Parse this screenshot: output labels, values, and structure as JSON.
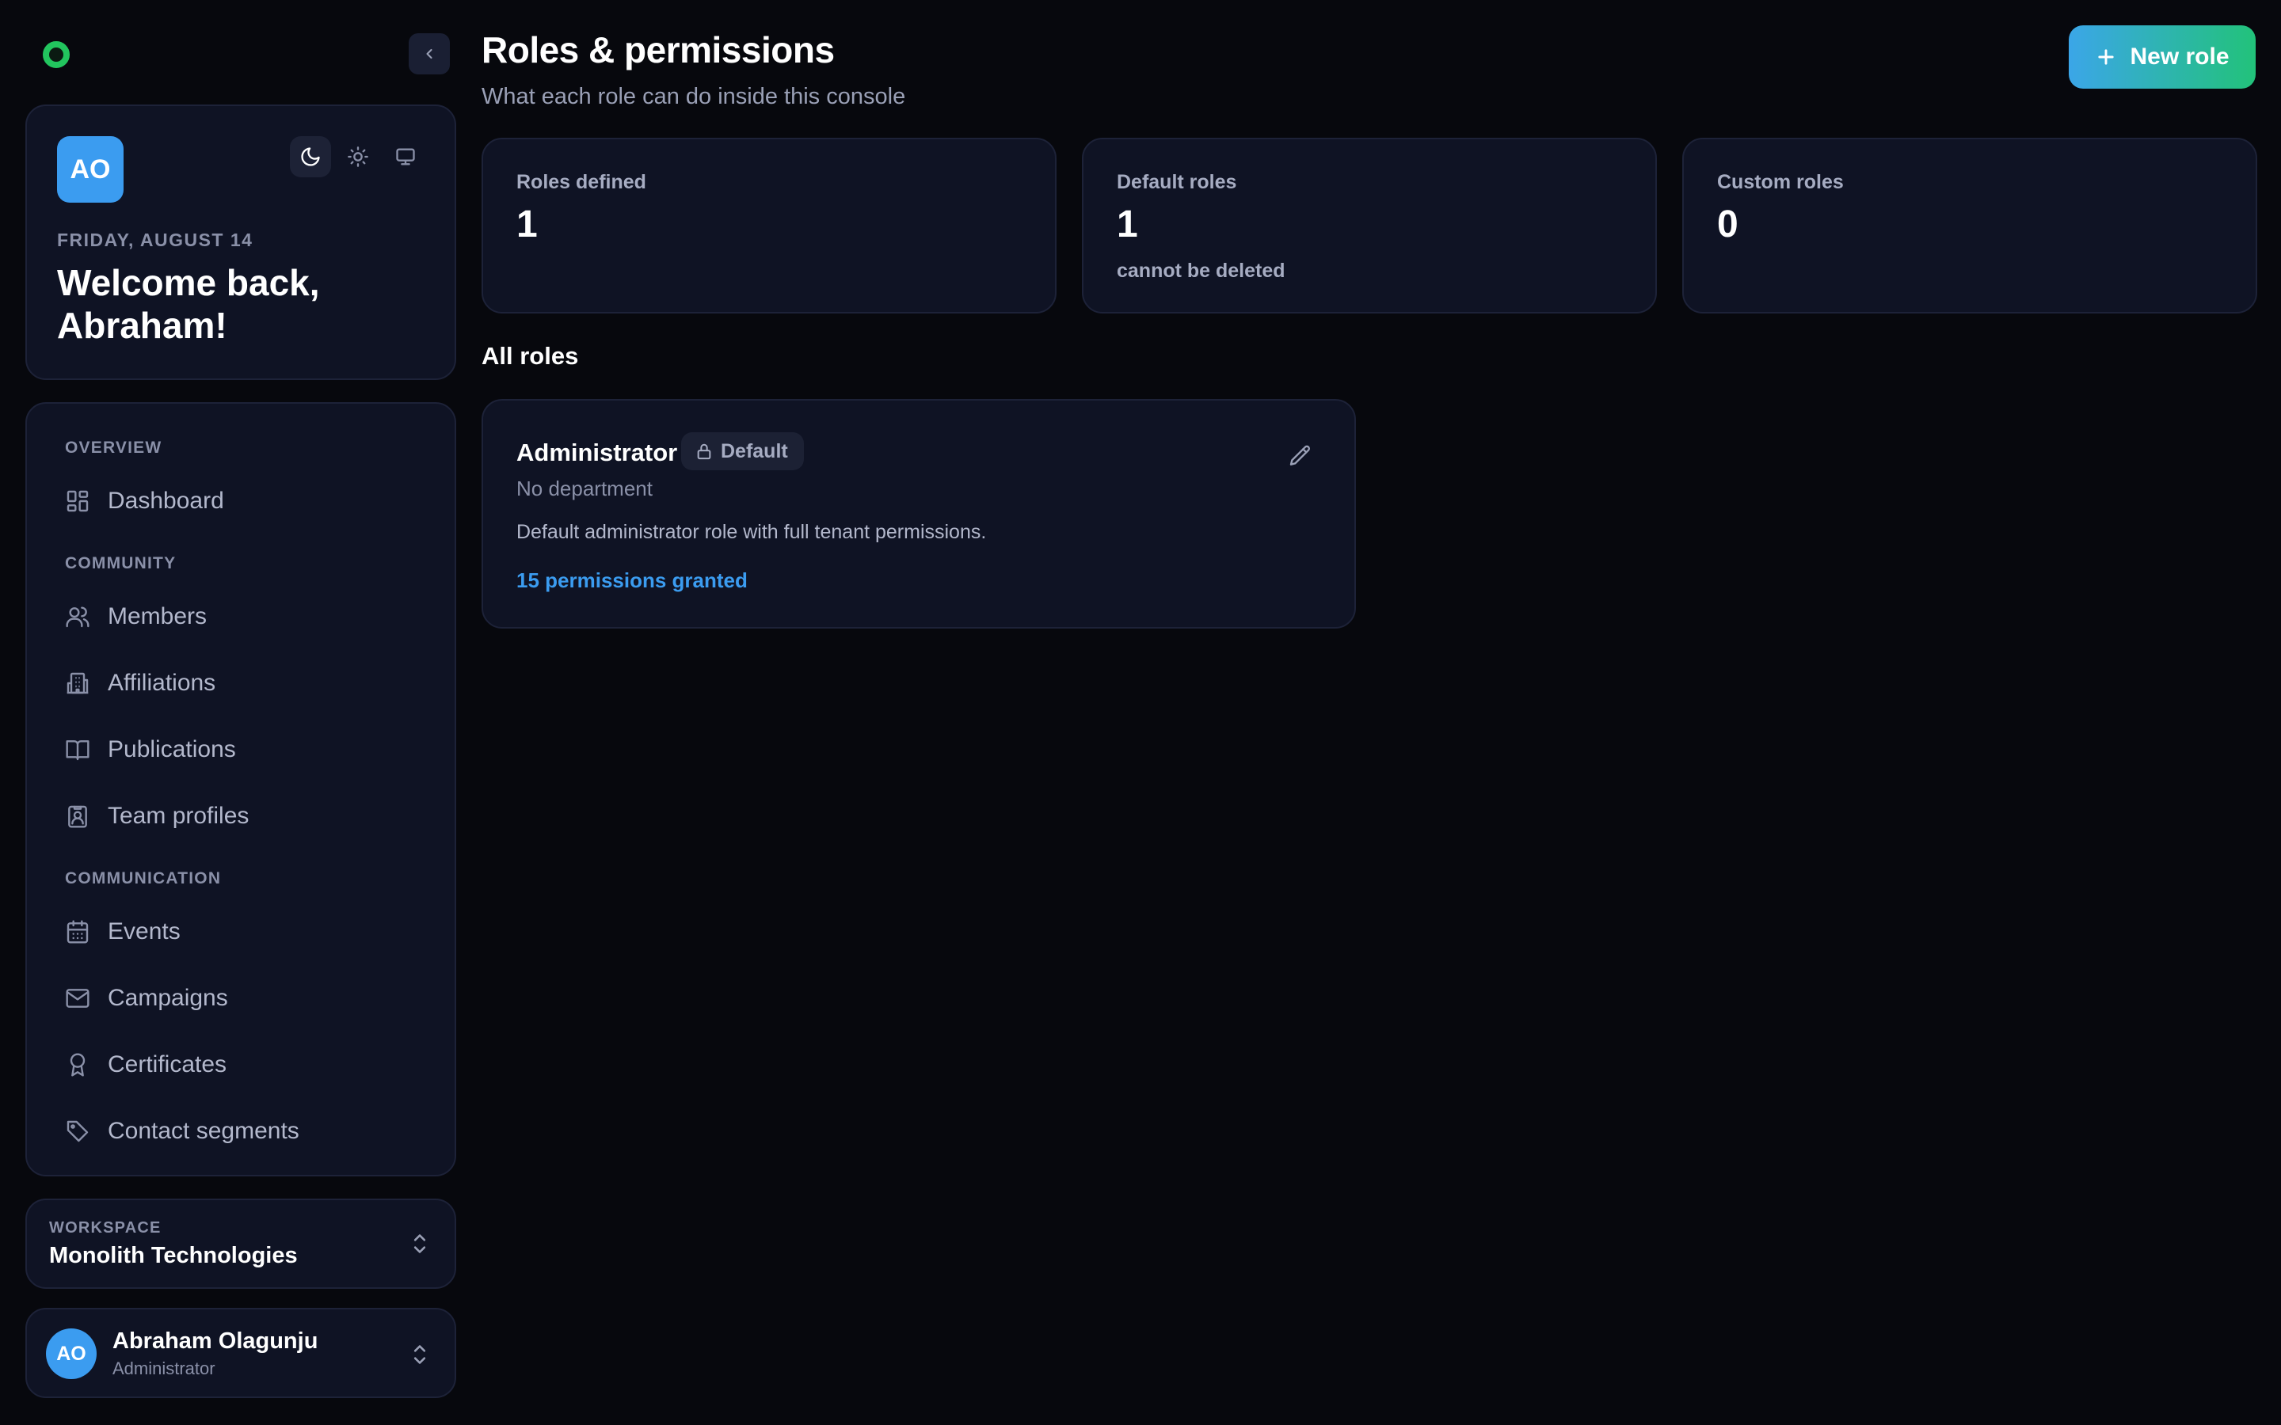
{
  "sidebar": {
    "profile": {
      "initials": "AO",
      "date": "FRIDAY, AUGUST 14",
      "welcome": "Welcome back, Abraham!"
    },
    "sections": [
      {
        "title": "OVERVIEW"
      },
      {
        "title": "COMMUNITY"
      },
      {
        "title": "COMMUNICATION"
      }
    ],
    "items": [
      {
        "label": "Dashboard",
        "icon": "dashboard-icon"
      },
      {
        "label": "Members",
        "icon": "users-icon"
      },
      {
        "label": "Affiliations",
        "icon": "building-icon"
      },
      {
        "label": "Publications",
        "icon": "book-icon"
      },
      {
        "label": "Team profiles",
        "icon": "id-badge-icon"
      },
      {
        "label": "Events",
        "icon": "calendar-icon"
      },
      {
        "label": "Campaigns",
        "icon": "mail-icon"
      },
      {
        "label": "Certificates",
        "icon": "award-icon"
      },
      {
        "label": "Contact segments",
        "icon": "tag-icon"
      }
    ],
    "workspace": {
      "label": "WORKSPACE",
      "name": "Monolith Technologies"
    },
    "user": {
      "initials": "AO",
      "name": "Abraham Olagunju",
      "role": "Administrator"
    }
  },
  "header": {
    "title": "Roles & permissions",
    "subtitle": "What each role can do inside this console",
    "new_role_label": "New role"
  },
  "stats": [
    {
      "label": "Roles defined",
      "value": "1",
      "note": ""
    },
    {
      "label": "Default roles",
      "value": "1",
      "note": "cannot be deleted"
    },
    {
      "label": "Custom roles",
      "value": "0",
      "note": ""
    }
  ],
  "roles_section": {
    "title": "All roles",
    "roles": [
      {
        "name": "Administrator",
        "badge": "Default",
        "department": "No department",
        "description": "Default administrator role with full tenant permissions.",
        "permissions": "15 permissions granted"
      }
    ]
  },
  "colors": {
    "background": "#07080d",
    "panel": "#0f1324",
    "accent_blue": "#3b9cf0",
    "accent_green": "#22c55e"
  }
}
